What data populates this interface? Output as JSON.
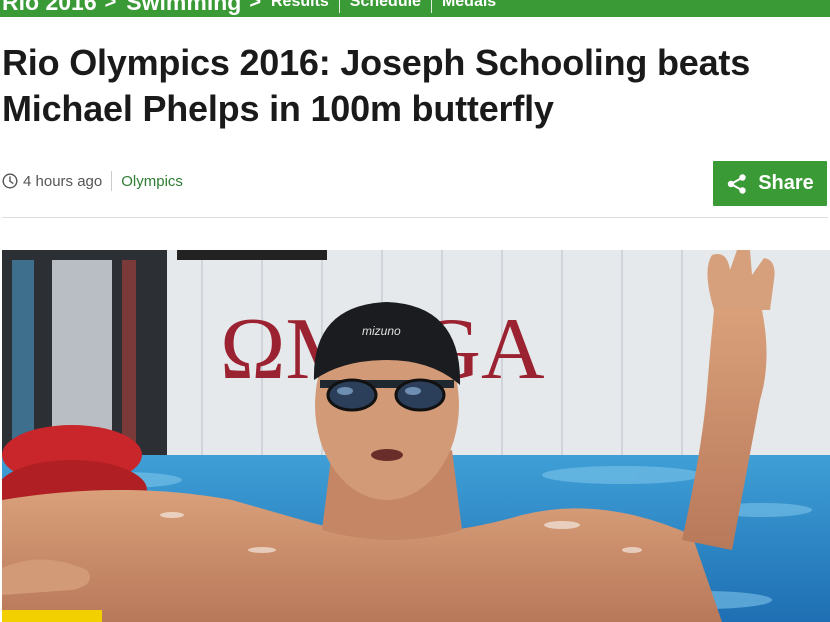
{
  "nav": {
    "breadcrumb": [
      "Rio 2016",
      "Swimming"
    ],
    "separator": ">",
    "links": [
      "Results",
      "Schedule",
      "Medals"
    ]
  },
  "article": {
    "headline": "Rio Olympics 2016: Joseph Schooling beats Michael Phelps in 100m butterfly",
    "timestamp": "4 hours ago",
    "section": "Olympics",
    "share_label": "Share"
  },
  "photo": {
    "banner_text": "ΩMEGA",
    "cap_logo": "mizuno"
  },
  "colors": {
    "brand_green": "#3a9a35",
    "section_link": "#2e7d32",
    "omega_red": "#9b2230"
  },
  "icons": {
    "clock": "clock-icon",
    "share": "share-icon"
  }
}
